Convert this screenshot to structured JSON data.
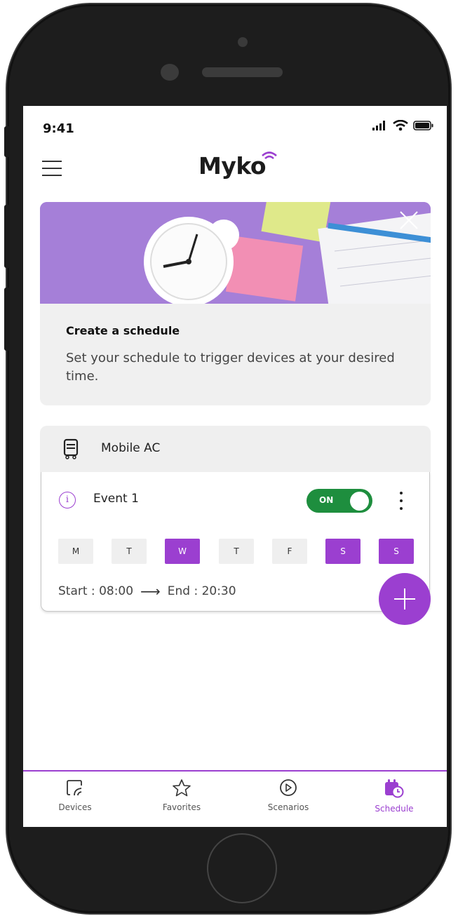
{
  "status_bar": {
    "time": "9:41",
    "icons": [
      "signal-icon",
      "wifi-icon",
      "battery-icon"
    ]
  },
  "header": {
    "logo_text": "Myko",
    "menu_icon": "hamburger-menu-icon"
  },
  "promo": {
    "title": "Create a schedule",
    "description": "Set your schedule to trigger devices at your desired time.",
    "close_icon": "close-icon"
  },
  "device": {
    "name": "Mobile AC",
    "icon": "air-conditioner-icon",
    "event": {
      "name": "Event 1",
      "toggle_label": "ON",
      "toggle_on": true,
      "days": [
        {
          "label": "M",
          "active": false
        },
        {
          "label": "T",
          "active": false
        },
        {
          "label": "W",
          "active": true
        },
        {
          "label": "T",
          "active": false
        },
        {
          "label": "F",
          "active": false
        },
        {
          "label": "S",
          "active": true
        },
        {
          "label": "S",
          "active": true
        }
      ],
      "start": "Start : 08:00",
      "arrow": "⟶",
      "end": "End : 20:30"
    }
  },
  "fab": {
    "icon": "plus-icon"
  },
  "tabs": [
    {
      "label": "Devices",
      "icon": "devices-icon",
      "active": false
    },
    {
      "label": "Favorites",
      "icon": "star-icon",
      "active": false
    },
    {
      "label": "Scenarios",
      "icon": "play-circle-icon",
      "active": false
    },
    {
      "label": "Schedule",
      "icon": "calendar-clock-icon",
      "active": true
    }
  ],
  "colors": {
    "accent": "#9b3fd0",
    "toggle_on": "#1e8e3e"
  }
}
